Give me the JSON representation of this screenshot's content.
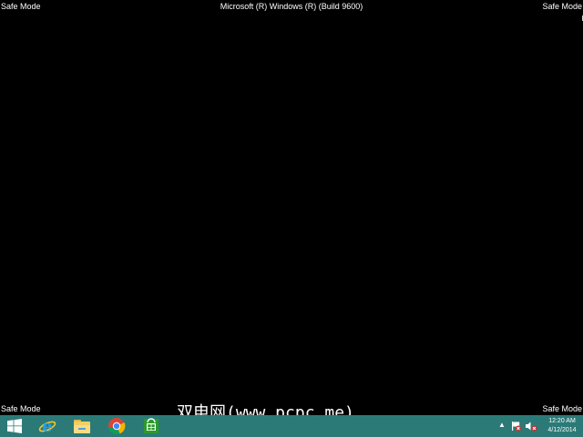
{
  "screen": {
    "top_left_label": "Safe Mode",
    "top_right_label": "Safe Mode",
    "bottom_left_label": "Safe Mode",
    "bottom_right_label": "Safe Mode",
    "build_string": "Microsoft (R) Windows (R) (Build 9600)",
    "background_color": "#000000"
  },
  "watermark": {
    "text": "双电网(www.pcpc.me)"
  },
  "taskbar": {
    "color": "#2b7a78",
    "pinned": [
      {
        "name": "start",
        "icon": "windows-logo-icon"
      },
      {
        "name": "internet-explorer",
        "icon": "internet-explorer-icon"
      },
      {
        "name": "file-explorer",
        "icon": "folder-icon"
      },
      {
        "name": "chrome",
        "icon": "chrome-icon"
      },
      {
        "name": "store",
        "icon": "store-icon"
      }
    ],
    "tray": {
      "chevron": "▲",
      "icons": [
        "action-center-flag-icon",
        "volume-muted-icon"
      ],
      "time": "12:20 AM",
      "date": "4/12/2014"
    }
  }
}
